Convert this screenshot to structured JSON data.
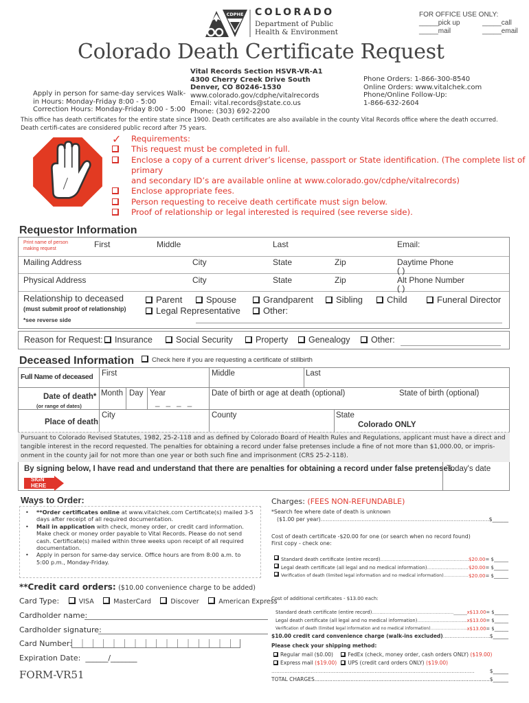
{
  "header": {
    "logo": {
      "badge": "CDPHE",
      "monogram": "CO",
      "state": "COLORADO",
      "dept_line1": "Department of Public",
      "dept_line2": "Health & Environment"
    },
    "office_use": {
      "title": "FOR OFFICE USE ONLY:",
      "items": [
        "_____pick up",
        "_____call",
        "_____mail",
        "_____email"
      ]
    },
    "title": "Colorado Death Certificate Request"
  },
  "contact": {
    "walk_in": [
      "Apply in person for same-day services Walk-",
      "in Hours: Monday-Friday  8:00 - 5:00",
      "Correction Hours: Monday-Friday 8:00 - 5:00"
    ],
    "address": [
      "Vital Records Section HSVR-VR-A1",
      "4300 Cherry Creek Drive South",
      "Denver, CO 80246-1530"
    ],
    "web": "www.colorado.gov/cdphe/vitalrecords",
    "email": "Email: vital.records@state.co.us",
    "phone": "Phone: (303) 692-2200",
    "orders": [
      "Phone Orders: 1-866-300-8540",
      "Online Orders: www.vitalchek.com",
      "Phone/Online Follow-Up:",
      "1-866-632-2604"
    ]
  },
  "intro": "This office has death certificates for the entire state since 1900. Death certificates are also available in the county Vital Records office where the death occurred.  Death certifi-cates are considered public record after 75 years.",
  "requirements": {
    "title": "Requirements:",
    "items": [
      "This request must be completed in full.",
      "Enclose a copy of a current driver’s license, passport or State identification. (The complete list of  primary",
      "Enclose appropriate fees.",
      "Person requesting to receive death certificate must sign below.",
      "Proof of relationship or legal interested is required (see reverse side)."
    ],
    "item2_cont": "and secondary ID’s are available online at www.colorado.gov/cdphe/vitalrecords)"
  },
  "requestor": {
    "heading": "Requestor Information",
    "print_hint": [
      "Print name of person",
      "making request"
    ],
    "name_fields": [
      "First",
      "Middle",
      "Last",
      "Email:"
    ],
    "mailing": [
      "Mailing Address",
      "City",
      "State",
      "Zip",
      "Daytime Phone"
    ],
    "physical": [
      "Physical Address",
      "City",
      "State",
      "Zip",
      "Alt Phone Number"
    ],
    "phone_paren": "(        )",
    "relationship": {
      "label": "Relationship to deceased",
      "note": "(must submit proof of relationship)",
      "see": "*see reverse side",
      "options": [
        "Parent",
        "Spouse",
        "Grandparent",
        "Sibling",
        "Child",
        "Funeral Director",
        "Legal Representative",
        "Other:"
      ]
    },
    "reason": {
      "label": "Reason for Request:",
      "options": [
        "Insurance",
        "Social Security",
        "Property",
        "Genealogy",
        "Other:"
      ]
    }
  },
  "deceased": {
    "heading": "Deceased Information",
    "stillbirth": "Check here if you are requesting  a certificate of stillbirth",
    "full_name": "Full Name of deceased",
    "name_fields": [
      "First",
      "Middle",
      "Last"
    ],
    "date_label": "Date of death*",
    "date_note": "(or range of dates)",
    "date_fields": [
      "Month",
      "Day",
      "Year"
    ],
    "dob": "Date of birth or age at death (optional)",
    "state_birth": "State of birth (optional)",
    "place_label": "Place of death",
    "place_fields": [
      "City",
      "County",
      "State"
    ],
    "state_value": "Colorado ONLY"
  },
  "legal_text": "Pursuant to Colorado Revised Statutes, 1982, 25-2-118 and as defined by Colorado Board of Health Rules and Regulations, applicant must have a direct and tangible interest in the record requested. The penalties for obtaining a record under false pretenses include a fine of not more than $1,000.00, or impris-onment in the county jail for not more than one year or both such fine and imprisonment (CRS 25-2-118).",
  "signature": {
    "statement": "By signing below, I have read and understand that there are penalties for obtaining a record under false pretenses.",
    "date_label": "Today's date",
    "sign_here": [
      "SIGN",
      "HERE"
    ]
  },
  "ways": {
    "heading": "Ways to Order:",
    "items": [
      {
        "bold": "**Order certificates online",
        "text": " at www.vitalchek.com  Certificate(s) mailed 3-5 days after receipt of all required documentation."
      },
      {
        "bold": "Mail in application",
        "text": " with check, money order, or credit card information. Make check or money order payable to Vital Records. Please do not send cash. Certificate(s) mailed within three weeks upon receipt of all required documentation."
      },
      {
        "bold": "",
        "text": "Apply in person for same-day service. Office hours are from 8:00 a.m. to 5:00 p.m., Monday-Friday."
      }
    ]
  },
  "credit": {
    "heading": "**Credit card orders:",
    "note": "($10.00 convenience charge to be added)",
    "card_type": "Card Type:",
    "cards": [
      "VISA",
      "MasterCard",
      "Discover",
      "American Express"
    ],
    "holder_name": "Cardholder name:",
    "holder_sig": "Cardholder signature:",
    "card_number": "Card Number:",
    "expiration": "Expiration Date:",
    "exp_value": "______/_______"
  },
  "form_id": "FORM-VR51",
  "charges": {
    "heading": "Charges:",
    "nonref": "(FEES NON-REFUNDABLE)",
    "search_fee": "*Search fee where date of death is unknown",
    "search_rate": "($1.00 per year)",
    "cost_first": "Cost of death certificate -$20.00 for one (or search when no record found)",
    "first_copy": "First copy - check one:",
    "first_items": [
      {
        "label": "Standard death certificate (entire record)",
        "price": "$20.00"
      },
      {
        "label": "Legal death certificate (all legal and no medical information)",
        "price": "$20.00"
      },
      {
        "label": "Verification of death (limited legal information and no medical information)",
        "price": "$20.00"
      }
    ],
    "additional": "Cost of additional certificates - $13.00 each:",
    "add_items": [
      {
        "label": "Standard death certificate (entire record)",
        "price": "x$13.00"
      },
      {
        "label": "Legal death certificate (all legal and no medical information)",
        "price": "x$13.00"
      },
      {
        "label": "Verification of death (limited legal information and no medical information)",
        "price": "x$13.00"
      }
    ],
    "convenience": "$10.00 credit card convenience charge (walk-ins excluded)",
    "shipping_heading": "Please check your shipping method:",
    "shipping": [
      {
        "label": "Regular mail ($0.00)",
        "price": ""
      },
      {
        "label": "FedEx (check, money order, cash orders ONLY)",
        "price": "($19.00)"
      },
      {
        "label": "Express mail",
        "price": "($19.00)"
      },
      {
        "label": "UPS (credit card orders ONLY)",
        "price": "($19.00)"
      }
    ],
    "total": "TOTAL CHARGES",
    "amount": "= $______",
    "dollar": "$______"
  },
  "colors": {
    "accent_red": "#e0352b",
    "text": "#333333",
    "legal_bg": "#ededed"
  }
}
